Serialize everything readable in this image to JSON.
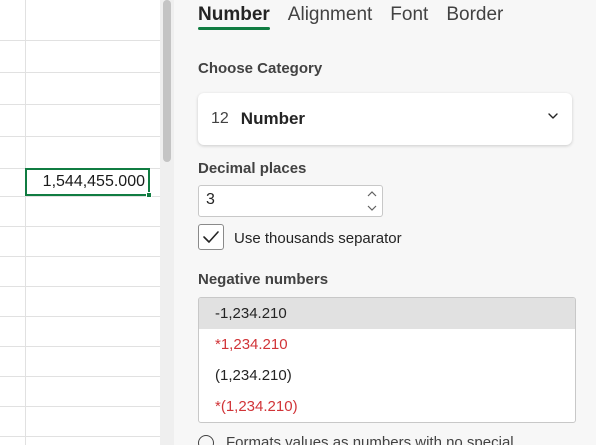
{
  "sheet": {
    "active_cell_value": "1,544,455.000"
  },
  "panel": {
    "tabs": [
      {
        "label": "Number",
        "active": true
      },
      {
        "label": "Alignment",
        "active": false
      },
      {
        "label": "Font",
        "active": false
      },
      {
        "label": "Border",
        "active": false
      }
    ],
    "category": {
      "label": "Choose Category",
      "icon_text": "12",
      "value": "Number",
      "icon": "chevron-down-icon"
    },
    "decimal": {
      "label": "Decimal places",
      "value": "3"
    },
    "thousands": {
      "label": "Use thousands separator",
      "checked": true
    },
    "negative": {
      "label": "Negative numbers",
      "options": [
        {
          "text": "-1,234.210",
          "color": "#242424",
          "selected": true
        },
        {
          "text": "*1,234.210",
          "color": "#d13438",
          "selected": false
        },
        {
          "text": "(1,234.210)",
          "color": "#242424",
          "selected": false
        },
        {
          "text": "*(1,234.210)",
          "color": "#d13438",
          "selected": false
        }
      ]
    },
    "footnote": "Formats values as numbers with no special"
  },
  "colors": {
    "accent": "#107c41",
    "negative_red": "#d13438"
  }
}
